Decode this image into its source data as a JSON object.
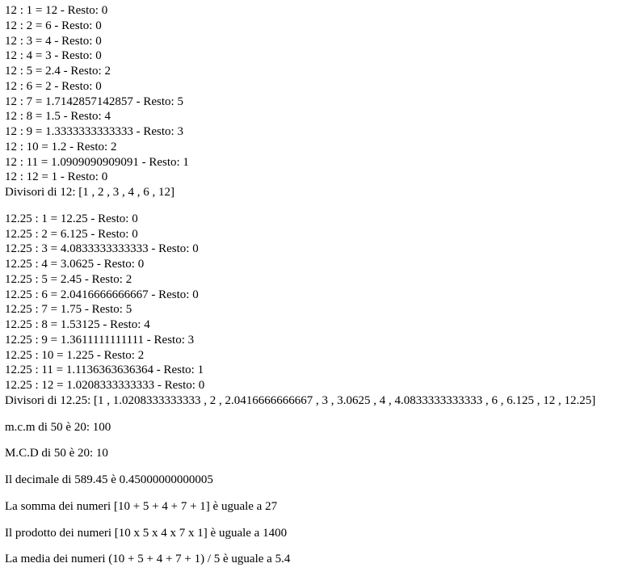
{
  "block1": {
    "lines": [
      "12 : 1 = 12 - Resto: 0",
      "12 : 2 = 6 - Resto: 0",
      "12 : 3 = 4 - Resto: 0",
      "12 : 4 = 3 - Resto: 0",
      "12 : 5 = 2.4 - Resto: 2",
      "12 : 6 = 2 - Resto: 0",
      "12 : 7 = 1.7142857142857 - Resto: 5",
      "12 : 8 = 1.5 - Resto: 4",
      "12 : 9 = 1.3333333333333 - Resto: 3",
      "12 : 10 = 1.2 - Resto: 2",
      "12 : 11 = 1.0909090909091 - Resto: 1",
      "12 : 12 = 1 - Resto: 0"
    ],
    "divisors": "Divisori di 12: [1 , 2 , 3 , 4 , 6 , 12]"
  },
  "block2": {
    "lines": [
      "12.25 : 1 = 12.25 - Resto: 0",
      "12.25 : 2 = 6.125 - Resto: 0",
      "12.25 : 3 = 4.0833333333333 - Resto: 0",
      "12.25 : 4 = 3.0625 - Resto: 0",
      "12.25 : 5 = 2.45 - Resto: 2",
      "12.25 : 6 = 2.0416666666667 - Resto: 0",
      "12.25 : 7 = 1.75 - Resto: 5",
      "12.25 : 8 = 1.53125 - Resto: 4",
      "12.25 : 9 = 1.3611111111111 - Resto: 3",
      "12.25 : 10 = 1.225 - Resto: 2",
      "12.25 : 11 = 1.1136363636364 - Resto: 1",
      "12.25 : 12 = 1.0208333333333 - Resto: 0"
    ],
    "divisors": "Divisori di 12.25: [1 , 1.0208333333333 , 2 , 2.0416666666667 , 3 , 3.0625 , 4 , 4.0833333333333 , 6 , 6.125 , 12 , 12.25]"
  },
  "mcm": "m.c.m di 50 è 20: 100",
  "mcd": "M.C.D di 50 è 20: 10",
  "decimal": "Il decimale di 589.45 è 0.45000000000005",
  "sum": "La somma dei numeri [10 + 5 + 4 + 7 + 1] è uguale a 27",
  "product": "Il prodotto dei numeri [10 x 5 x 4 x 7 x 1] è uguale a 1400",
  "mean": "La media dei numeri (10 + 5 + 4 + 7 + 1) / 5 è uguale a 5.4"
}
